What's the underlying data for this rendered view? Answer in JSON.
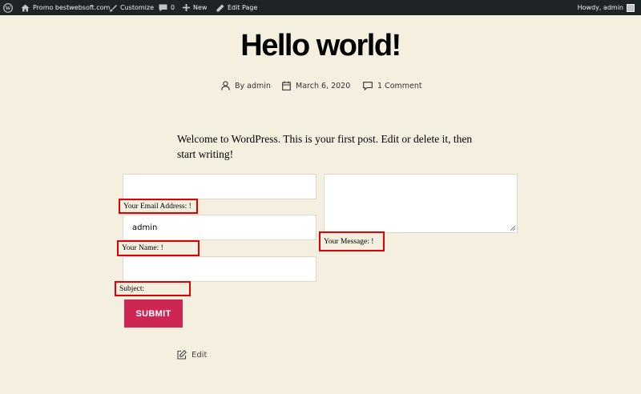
{
  "adminbar": {
    "wp_logo_icon": "wordpress-logo-icon",
    "site_name": "Promo bestwebsoft.com",
    "customize": "Customize",
    "comments_count": "0",
    "new": "New",
    "edit_page": "Edit Page",
    "howdy": "Howdy, admin"
  },
  "post": {
    "title": "Hello world!",
    "author": "By admin",
    "date": "March 6, 2020",
    "comments": "1 Comment",
    "body": "Welcome to WordPress. This is your first post. Edit or delete it, then start writing!"
  },
  "form": {
    "email_value": "",
    "email_label": "Your Email Address: !",
    "name_value": "admin",
    "name_label": "Your Name: !",
    "subject_value": "",
    "subject_label": "Subject:",
    "message_value": "",
    "message_label": "Your Message: !",
    "submit_label": "SUBMIT"
  },
  "edit_label": "Edit",
  "colors": {
    "background": "#f5efe0",
    "adminbar": "#1d2327",
    "accent": "#cd2653",
    "highlight": "#e00000"
  }
}
